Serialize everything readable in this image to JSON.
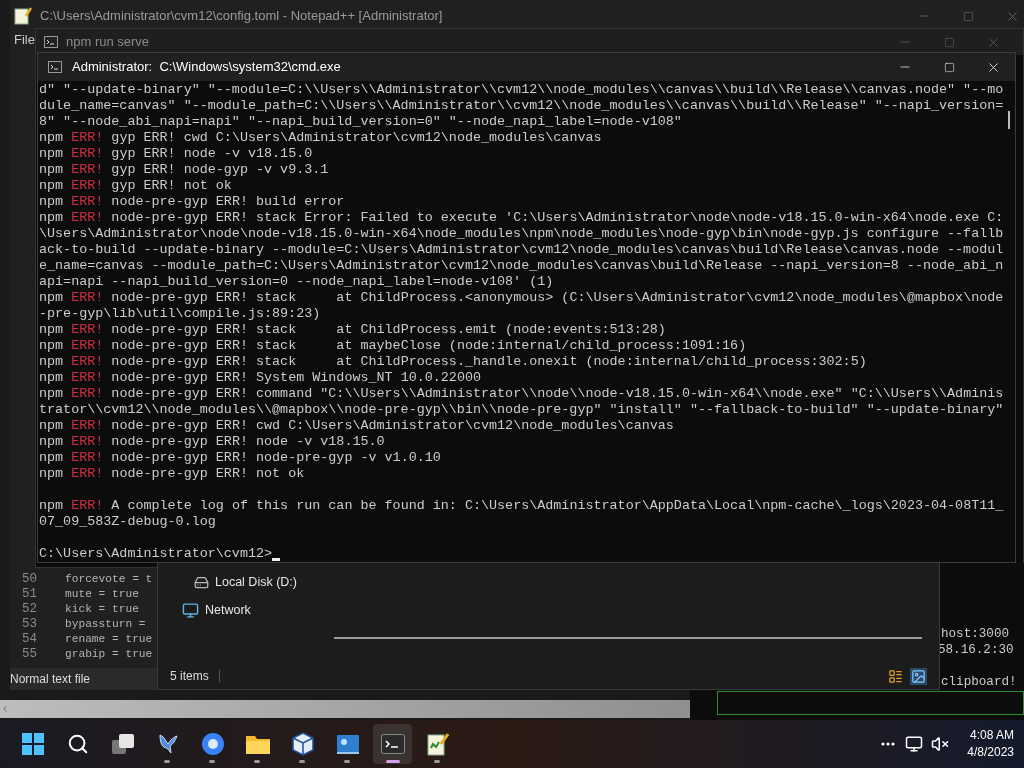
{
  "notepad": {
    "title": "C:\\Users\\Administrator\\cvm12\\config.toml - Notepad++ [Administrator]",
    "menu": [
      "File"
    ],
    "lines": [
      {
        "number": "50",
        "code": "forcevote = t"
      },
      {
        "number": "51",
        "code": "mute = true"
      },
      {
        "number": "52",
        "code": "kick = true"
      },
      {
        "number": "53",
        "code": "bypassturn ="
      },
      {
        "number": "54",
        "code": "rename = true"
      },
      {
        "number": "55",
        "code": "grabip = true"
      }
    ],
    "status": "Normal text file"
  },
  "npm_serve": {
    "title": "npm run serve",
    "output": [
      "host:3000",
      "58.16.2:30",
      "clipboard!"
    ]
  },
  "explorer": {
    "items": [
      {
        "kind": "drive",
        "label": "Local Disk (D:)"
      },
      {
        "kind": "network",
        "label": "Network"
      }
    ],
    "status": "5 items"
  },
  "cmd": {
    "title": "Administrator:  C:\\Windows\\system32\\cmd.exe",
    "lines": [
      {
        "kind": "plain",
        "text": "d\" \"--update-binary\" \"--module=C:\\\\Users\\\\Administrator\\\\cvm12\\\\node_modules\\\\canvas\\\\build\\\\Release\\\\canvas.node\" \"--mo"
      },
      {
        "kind": "plain",
        "text": "dule_name=canvas\" \"--module_path=C:\\\\Users\\\\Administrator\\\\cvm12\\\\node_modules\\\\canvas\\\\build\\\\Release\" \"--napi_version="
      },
      {
        "kind": "plain",
        "text": "8\" \"--node_abi_napi=napi\" \"--napi_build_version=0\" \"--node_napi_label=node-v108\""
      },
      {
        "kind": "err",
        "tag": "npm",
        "code": "ERR!",
        "text": "gyp ERR! cwd C:\\Users\\Administrator\\cvm12\\node_modules\\canvas"
      },
      {
        "kind": "err",
        "tag": "npm",
        "code": "ERR!",
        "text": "gyp ERR! node -v v18.15.0"
      },
      {
        "kind": "err",
        "tag": "npm",
        "code": "ERR!",
        "text": "gyp ERR! node-gyp -v v9.3.1"
      },
      {
        "kind": "err",
        "tag": "npm",
        "code": "ERR!",
        "text": "gyp ERR! not ok"
      },
      {
        "kind": "err",
        "tag": "npm",
        "code": "ERR!",
        "text": "node-pre-gyp ERR! build error"
      },
      {
        "kind": "err",
        "tag": "npm",
        "code": "ERR!",
        "text": "node-pre-gyp ERR! stack Error: Failed to execute 'C:\\Users\\Administrator\\node\\node-v18.15.0-win-x64\\node.exe C:"
      },
      {
        "kind": "plain",
        "text": "\\Users\\Administrator\\node\\node-v18.15.0-win-x64\\node_modules\\npm\\node_modules\\node-gyp\\bin\\node-gyp.js configure --fallb"
      },
      {
        "kind": "plain",
        "text": "ack-to-build --update-binary --module=C:\\Users\\Administrator\\cvm12\\node_modules\\canvas\\build\\Release\\canvas.node --modul"
      },
      {
        "kind": "plain",
        "text": "e_name=canvas --module_path=C:\\Users\\Administrator\\cvm12\\node_modules\\canvas\\build\\Release --napi_version=8 --node_abi_n"
      },
      {
        "kind": "plain",
        "text": "api=napi --napi_build_version=0 --node_napi_label=node-v108' (1)"
      },
      {
        "kind": "err",
        "tag": "npm",
        "code": "ERR!",
        "text": "node-pre-gyp ERR! stack     at ChildProcess.<anonymous> (C:\\Users\\Administrator\\cvm12\\node_modules\\@mapbox\\node"
      },
      {
        "kind": "plain",
        "text": "-pre-gyp\\lib\\util\\compile.js:89:23)"
      },
      {
        "kind": "err",
        "tag": "npm",
        "code": "ERR!",
        "text": "node-pre-gyp ERR! stack     at ChildProcess.emit (node:events:513:28)"
      },
      {
        "kind": "err",
        "tag": "npm",
        "code": "ERR!",
        "text": "node-pre-gyp ERR! stack     at maybeClose (node:internal/child_process:1091:16)"
      },
      {
        "kind": "err",
        "tag": "npm",
        "code": "ERR!",
        "text": "node-pre-gyp ERR! stack     at ChildProcess._handle.onexit (node:internal/child_process:302:5)"
      },
      {
        "kind": "err",
        "tag": "npm",
        "code": "ERR!",
        "text": "node-pre-gyp ERR! System Windows_NT 10.0.22000"
      },
      {
        "kind": "err",
        "tag": "npm",
        "code": "ERR!",
        "text": "node-pre-gyp ERR! command \"C:\\\\Users\\\\Administrator\\\\node\\\\node-v18.15.0-win-x64\\\\node.exe\" \"C:\\\\Users\\\\Adminis"
      },
      {
        "kind": "plain",
        "text": "trator\\\\cvm12\\\\node_modules\\\\@mapbox\\\\node-pre-gyp\\\\bin\\\\node-pre-gyp\" \"install\" \"--fallback-to-build\" \"--update-binary\""
      },
      {
        "kind": "err",
        "tag": "npm",
        "code": "ERR!",
        "text": "node-pre-gyp ERR! cwd C:\\Users\\Administrator\\cvm12\\node_modules\\canvas"
      },
      {
        "kind": "err",
        "tag": "npm",
        "code": "ERR!",
        "text": "node-pre-gyp ERR! node -v v18.15.0"
      },
      {
        "kind": "err",
        "tag": "npm",
        "code": "ERR!",
        "text": "node-pre-gyp ERR! node-pre-gyp -v v1.0.10"
      },
      {
        "kind": "err",
        "tag": "npm",
        "code": "ERR!",
        "text": "node-pre-gyp ERR! not ok"
      },
      {
        "kind": "blank"
      },
      {
        "kind": "err",
        "tag": "npm",
        "code": "ERR!",
        "text": "A complete log of this run can be found in: C:\\Users\\Administrator\\AppData\\Local\\npm-cache\\_logs\\2023-04-08T11_"
      },
      {
        "kind": "plain",
        "text": "07_09_583Z-debug-0.log"
      },
      {
        "kind": "blank"
      },
      {
        "kind": "prompt",
        "text": "C:\\Users\\Administrator\\cvm12>"
      }
    ]
  },
  "taskbar": {
    "apps": [
      {
        "kind": "start",
        "running": false,
        "selected": false
      },
      {
        "kind": "search",
        "running": false,
        "selected": false
      },
      {
        "kind": "taskview",
        "running": false,
        "selected": false
      },
      {
        "kind": "bird",
        "running": true,
        "selected": false
      },
      {
        "kind": "browser",
        "running": true,
        "selected": false
      },
      {
        "kind": "folder",
        "running": true,
        "selected": false
      },
      {
        "kind": "cube",
        "running": true,
        "selected": false
      },
      {
        "kind": "display",
        "running": true,
        "selected": false
      },
      {
        "kind": "terminal",
        "running": true,
        "selected": true
      },
      {
        "kind": "notepad",
        "running": true,
        "selected": false
      }
    ],
    "time": "4:08 AM",
    "date": "4/8/2023"
  }
}
